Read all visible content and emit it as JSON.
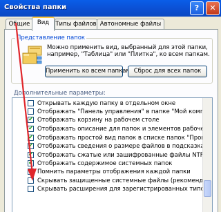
{
  "window": {
    "title": "Свойства папки",
    "help_label": "?",
    "close_label": "✕"
  },
  "tabs": [
    {
      "label": "Общие"
    },
    {
      "label": "Вид"
    },
    {
      "label": "Типы файлов"
    },
    {
      "label": "Автономные файлы"
    }
  ],
  "folder_view": {
    "legend": "Представление папок",
    "description": "Можно применить вид, выбранный для этой папки, например, \"Таблица\" или \"Плитка\", ко всем папкам.",
    "apply_label": "Применить ко всем папкам",
    "reset_label": "Сброс для всех папок"
  },
  "advanced": {
    "label": "Дополнительные параметры:",
    "items": [
      {
        "label": "Открывать каждую папку в отдельном окне",
        "checked": false
      },
      {
        "label": "Отображать \"Панель управления\" в папке \"Мой компьют",
        "checked": false
      },
      {
        "label": "Отображать корзину на рабочем столе",
        "checked": true
      },
      {
        "label": "Отображать описание для папок и элементов рабочего ст",
        "checked": true
      },
      {
        "label": "Отображать простой вид папок в списке папок \"Проводни",
        "checked": true
      },
      {
        "label": "Отображать сведения о размере файлов в подсказках па",
        "checked": true
      },
      {
        "label": "Отображать сжатые или зашифрованные файлы NTFS дру",
        "checked": true
      },
      {
        "label": "Отображать содержимое системных папок",
        "checked": true
      },
      {
        "label": "Помнить параметры отображения каждой папки",
        "checked": false
      },
      {
        "label": "Скрывать защищенные системные файлы (рекомендуется",
        "checked": false
      },
      {
        "label": "Скрывать расширения для зарегистрированных типов фай",
        "checked": false
      }
    ]
  },
  "colors": {
    "accent": "#0046d5",
    "check": "#21a121",
    "annotation": "#e0262b"
  }
}
